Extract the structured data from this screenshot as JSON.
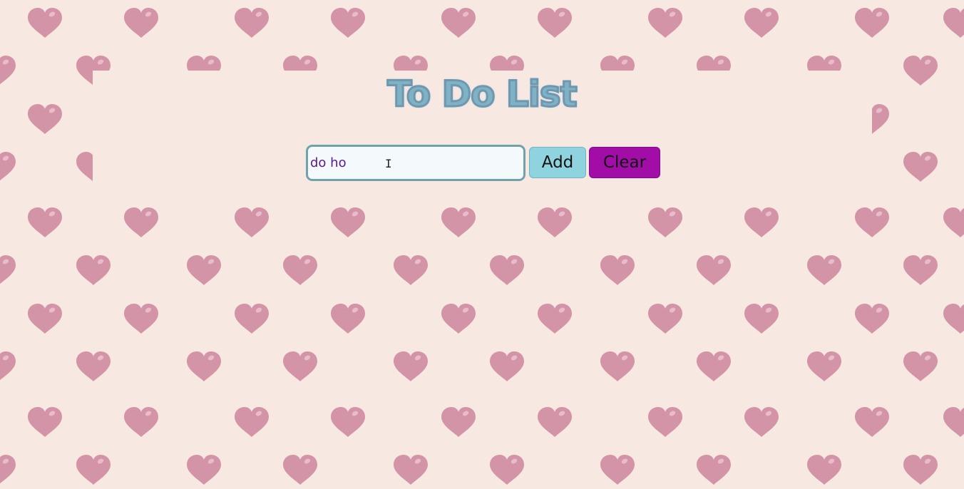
{
  "app": {
    "title": "To Do List"
  },
  "form": {
    "input_value": "do ho",
    "add_label": "Add",
    "clear_label": "Clear"
  },
  "colors": {
    "background": "#f8e8e2",
    "heart": "#d494a8",
    "title": "#7fb2c4",
    "add_button": "#8fd3df",
    "clear_button": "#a20da8",
    "input_text": "#5a1796"
  },
  "icons": {
    "background_pattern": "heart-icon",
    "cursor": "text-cursor-icon"
  }
}
